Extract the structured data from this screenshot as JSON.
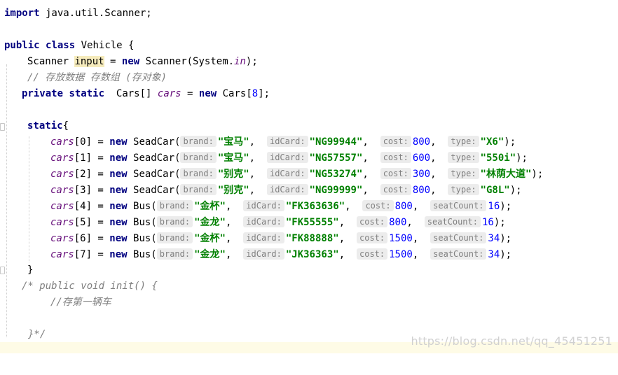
{
  "code": {
    "l1": {
      "kw": "import",
      "rest": " java.util.Scanner;"
    },
    "l3": {
      "kw1": "public",
      "kw2": "class",
      "rest": " Vehicle {"
    },
    "l4": {
      "type": "Scanner ",
      "var": "input",
      "eq": " = ",
      "kw": "new",
      "rest": " Scanner(System.",
      "field": "in",
      "end": ");"
    },
    "l5": {
      "comment": "// 存放数据 存数组 (存对象)"
    },
    "l6": {
      "kw1": "private",
      "kw2": "static",
      "type": "  Cars[] ",
      "field": "cars",
      "eq": " = ",
      "kw3": "new",
      "rest": " Cars[",
      "num": "8",
      "end": "];"
    },
    "l8": {
      "kw": "static",
      "rest": "{"
    },
    "rows": [
      {
        "field": "cars",
        "idx": "[0] = ",
        "kw": "new",
        "cls": " SeadCar(",
        "h1": "brand:",
        "v1": "\"宝马\"",
        "h2": "idCard:",
        "v2": "\"NG99944\"",
        "h3": "cost:",
        "v3": "800",
        "h4": "type:",
        "v4": "\"X6\"",
        "v4num": false,
        "end": ");"
      },
      {
        "field": "cars",
        "idx": "[1] = ",
        "kw": "new",
        "cls": " SeadCar(",
        "h1": "brand:",
        "v1": "\"宝马\"",
        "h2": "idCard:",
        "v2": "\"NG57557\"",
        "h3": "cost:",
        "v3": "600",
        "h4": "type:",
        "v4": "\"550i\"",
        "v4num": false,
        "end": ");"
      },
      {
        "field": "cars",
        "idx": "[2] = ",
        "kw": "new",
        "cls": " SeadCar(",
        "h1": "brand:",
        "v1": "\"别克\"",
        "h2": "idCard:",
        "v2": "\"NG53274\"",
        "h3": "cost:",
        "v3": "300",
        "h4": "type:",
        "v4": "\"林荫大道\"",
        "v4num": false,
        "end": ");"
      },
      {
        "field": "cars",
        "idx": "[3] = ",
        "kw": "new",
        "cls": " SeadCar(",
        "h1": "brand:",
        "v1": "\"别克\"",
        "h2": "idCard:",
        "v2": "\"NG99999\"",
        "h3": "cost:",
        "v3": "800",
        "h4": "type:",
        "v4": "\"G8L\"",
        "v4num": false,
        "end": ");"
      },
      {
        "field": "cars",
        "idx": "[4] = ",
        "kw": "new",
        "cls": " Bus(",
        "h1": "brand:",
        "v1": "\"金杯\"",
        "h2": "idCard:",
        "v2": "\"FK363636\"",
        "h3": "cost:",
        "v3": "800",
        "h4": "seatCount:",
        "v4": "16",
        "v4num": true,
        "end": ");"
      },
      {
        "field": "cars",
        "idx": "[5] = ",
        "kw": "new",
        "cls": " Bus(",
        "h1": "brand:",
        "v1": "\"金龙\"",
        "h2": "idCard:",
        "v2": "\"FK55555\"",
        "h3": "cost:",
        "v3": "800",
        "h4": "seatCount:",
        "v4": "16",
        "v4num": true,
        "end": ");"
      },
      {
        "field": "cars",
        "idx": "[6] = ",
        "kw": "new",
        "cls": " Bus(",
        "h1": "brand:",
        "v1": "\"金杯\"",
        "h2": "idCard:",
        "v2": "\"FK88888\"",
        "h3": "cost:",
        "v3": "1500",
        "h4": "seatCount:",
        "v4": "34",
        "v4num": true,
        "end": ");"
      },
      {
        "field": "cars",
        "idx": "[7] = ",
        "kw": "new",
        "cls": " Bus(",
        "h1": "brand:",
        "v1": "\"金龙\"",
        "h2": "idCard:",
        "v2": "\"JK36363\"",
        "h3": "cost:",
        "v3": "1500",
        "h4": "seatCount:",
        "v4": "34",
        "v4num": true,
        "end": ");"
      }
    ],
    "l17": {
      "rest": "}"
    },
    "l18": {
      "comment": "/* public void init() {"
    },
    "l19": {
      "comment": "//存第一辆车"
    },
    "l21": {
      "comment": "}*/"
    }
  },
  "watermark": "https://blog.csdn.net/qq_45451251",
  "colors": {
    "keyword": "#000080",
    "field": "#660e7a",
    "comment": "#808080",
    "string": "#008000",
    "number": "#0000ff",
    "highlight": "#f6ebbc"
  }
}
